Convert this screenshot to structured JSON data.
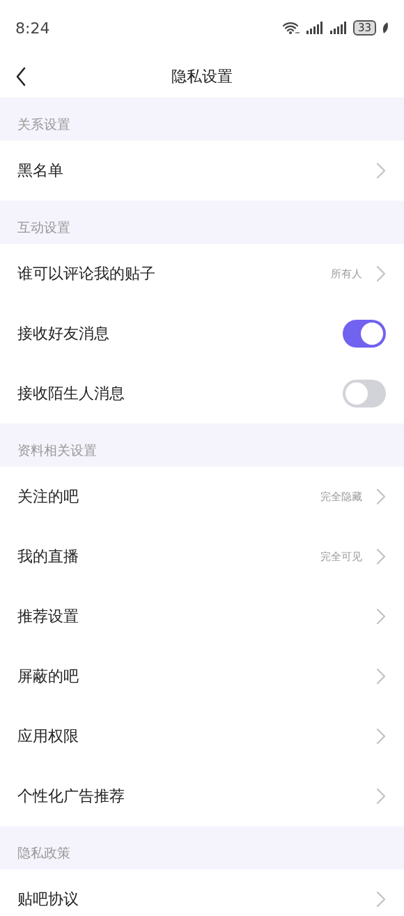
{
  "status_bar": {
    "time": "8:24",
    "battery": "33"
  },
  "nav": {
    "title": "隐私设置"
  },
  "sections": [
    {
      "title": "关系设置",
      "items": [
        {
          "kind": "link",
          "label": "黑名单"
        }
      ]
    },
    {
      "title": "互动设置",
      "items": [
        {
          "kind": "link",
          "label": "谁可以评论我的贴子",
          "value": "所有人"
        },
        {
          "kind": "toggle",
          "label": "接收好友消息",
          "on": true
        },
        {
          "kind": "toggle",
          "label": "接收陌生人消息",
          "on": false
        }
      ]
    },
    {
      "title": "资料相关设置",
      "items": [
        {
          "kind": "link",
          "label": "关注的吧",
          "value": "完全隐藏"
        },
        {
          "kind": "link",
          "label": "我的直播",
          "value": "完全可见"
        },
        {
          "kind": "link",
          "label": "推荐设置"
        },
        {
          "kind": "link",
          "label": "屏蔽的吧"
        },
        {
          "kind": "link",
          "label": "应用权限"
        },
        {
          "kind": "link",
          "label": "个性化广告推荐"
        }
      ]
    },
    {
      "title": "隐私政策",
      "items": [
        {
          "kind": "link",
          "label": "贴吧协议"
        }
      ]
    }
  ]
}
